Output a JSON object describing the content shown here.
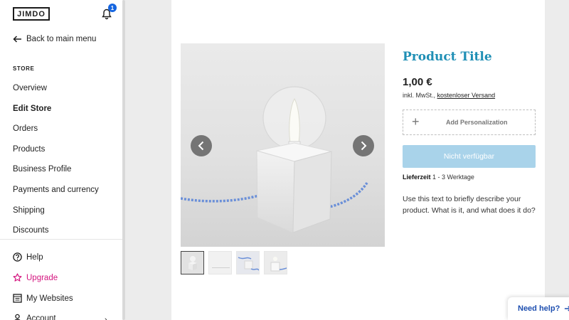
{
  "sidebar": {
    "logo": "JIMDO",
    "notifications_count": "1",
    "back_label": "Back to main menu",
    "section_label": "STORE",
    "items": [
      {
        "label": "Overview"
      },
      {
        "label": "Edit Store"
      },
      {
        "label": "Orders"
      },
      {
        "label": "Products"
      },
      {
        "label": "Business Profile"
      },
      {
        "label": "Payments and currency"
      },
      {
        "label": "Shipping"
      },
      {
        "label": "Discounts"
      }
    ],
    "bottom": [
      {
        "label": "Help",
        "icon": "question-circle-icon"
      },
      {
        "label": "Upgrade",
        "icon": "star-icon"
      },
      {
        "label": "My Websites",
        "icon": "websites-list-icon"
      },
      {
        "label": "Account",
        "icon": "user-icon"
      }
    ]
  },
  "product": {
    "title": "Product Title",
    "price": "1,00 €",
    "tax_prefix": "inkl. MwSt.,",
    "shipping_link": "kostenloser Versand",
    "personalization_label": "Add Personalization",
    "buy_button": "Nicht verfügbar",
    "delivery_label": "Lieferzeit",
    "delivery_value": "1 - 3 Werktage",
    "description": "Use this text to briefly describe your product. What is it, and what does it do?"
  },
  "help": {
    "label": "Need help?"
  },
  "colors": {
    "accent_title": "#1f8fb5",
    "upgrade": "#d4157f",
    "buy_button": "#a9d3ea",
    "badge": "#1565e0",
    "help_text": "#1e4fb0"
  }
}
